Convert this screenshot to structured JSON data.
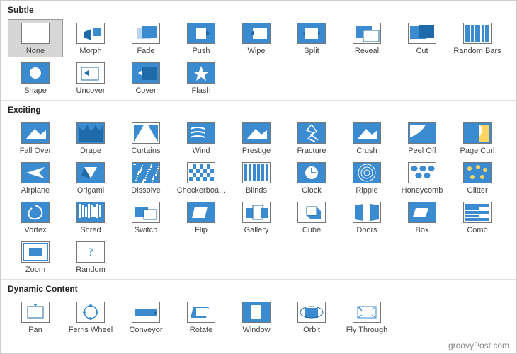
{
  "watermark": "groovyPost.com",
  "sections": [
    {
      "title": "Subtle",
      "items": [
        {
          "name": "none",
          "label": "None",
          "selected": true,
          "icon": "none"
        },
        {
          "name": "morph",
          "label": "Morph",
          "icon": "morph"
        },
        {
          "name": "fade",
          "label": "Fade",
          "icon": "fade"
        },
        {
          "name": "push",
          "label": "Push",
          "icon": "push"
        },
        {
          "name": "wipe",
          "label": "Wipe",
          "icon": "wipe"
        },
        {
          "name": "split",
          "label": "Split",
          "icon": "split"
        },
        {
          "name": "reveal",
          "label": "Reveal",
          "icon": "reveal"
        },
        {
          "name": "cut",
          "label": "Cut",
          "icon": "cut"
        },
        {
          "name": "random-bars",
          "label": "Random Bars",
          "icon": "random-bars"
        },
        {
          "name": "shape",
          "label": "Shape",
          "icon": "shape"
        },
        {
          "name": "uncover",
          "label": "Uncover",
          "icon": "uncover"
        },
        {
          "name": "cover",
          "label": "Cover",
          "icon": "cover"
        },
        {
          "name": "flash",
          "label": "Flash",
          "icon": "flash"
        }
      ]
    },
    {
      "title": "Exciting",
      "items": [
        {
          "name": "fall-over",
          "label": "Fall Over",
          "icon": "generic"
        },
        {
          "name": "drape",
          "label": "Drape",
          "icon": "drape"
        },
        {
          "name": "curtains",
          "label": "Curtains",
          "icon": "curtains"
        },
        {
          "name": "wind",
          "label": "Wind",
          "icon": "wind"
        },
        {
          "name": "prestige",
          "label": "Prestige",
          "icon": "generic"
        },
        {
          "name": "fracture",
          "label": "Fracture",
          "icon": "fracture"
        },
        {
          "name": "crush",
          "label": "Crush",
          "icon": "generic"
        },
        {
          "name": "peel-off",
          "label": "Peel Off",
          "icon": "peel"
        },
        {
          "name": "page-curl",
          "label": "Page Curl",
          "icon": "curl"
        },
        {
          "name": "airplane",
          "label": "Airplane",
          "icon": "airplane"
        },
        {
          "name": "origami",
          "label": "Origami",
          "icon": "origic"
        },
        {
          "name": "dissolve",
          "label": "Dissolve",
          "icon": "dissolve"
        },
        {
          "name": "checkerboard",
          "label": "Checkerboa...",
          "icon": "checker"
        },
        {
          "name": "blinds",
          "label": "Blinds",
          "icon": "blinds"
        },
        {
          "name": "clock",
          "label": "Clock",
          "icon": "clock"
        },
        {
          "name": "ripple",
          "label": "Ripple",
          "icon": "ripple"
        },
        {
          "name": "honeycomb",
          "label": "Honeycomb",
          "icon": "honey"
        },
        {
          "name": "glitter",
          "label": "Glitter",
          "icon": "glitter"
        },
        {
          "name": "vortex",
          "label": "Vortex",
          "icon": "vortex"
        },
        {
          "name": "shred",
          "label": "Shred",
          "icon": "shred"
        },
        {
          "name": "switch",
          "label": "Switch",
          "icon": "switch"
        },
        {
          "name": "flip",
          "label": "Flip",
          "icon": "flip"
        },
        {
          "name": "gallery",
          "label": "Gallery",
          "icon": "gallery"
        },
        {
          "name": "cube",
          "label": "Cube",
          "icon": "cube"
        },
        {
          "name": "doors",
          "label": "Doors",
          "icon": "doors"
        },
        {
          "name": "box",
          "label": "Box",
          "icon": "box"
        },
        {
          "name": "comb",
          "label": "Comb",
          "icon": "comb"
        },
        {
          "name": "zoom",
          "label": "Zoom",
          "icon": "zoom"
        },
        {
          "name": "random",
          "label": "Random",
          "icon": "random"
        }
      ]
    },
    {
      "title": "Dynamic Content",
      "items": [
        {
          "name": "pan",
          "label": "Pan",
          "icon": "pan"
        },
        {
          "name": "ferris-wheel",
          "label": "Ferris Wheel",
          "icon": "ferris"
        },
        {
          "name": "conveyor",
          "label": "Conveyor",
          "icon": "conveyor"
        },
        {
          "name": "rotate",
          "label": "Rotate",
          "icon": "rotate"
        },
        {
          "name": "window",
          "label": "Window",
          "icon": "window"
        },
        {
          "name": "orbit",
          "label": "Orbit",
          "icon": "orbit"
        },
        {
          "name": "fly-through",
          "label": "Fly Through",
          "icon": "fly"
        }
      ]
    }
  ]
}
